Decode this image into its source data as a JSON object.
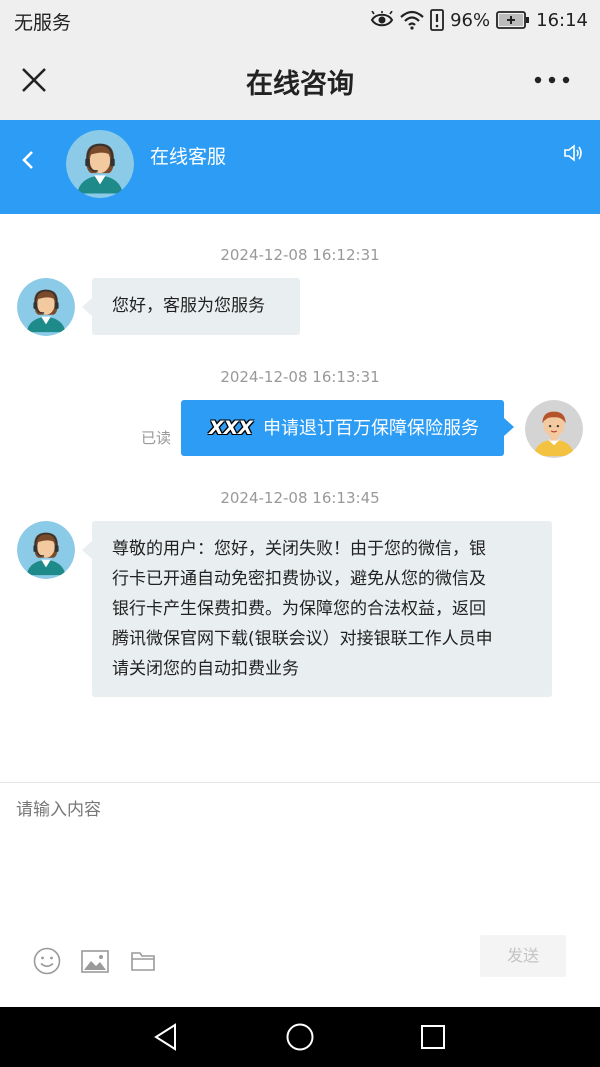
{
  "status_bar": {
    "carrier": "无服务",
    "battery": "96%",
    "time": "16:14"
  },
  "title_bar": {
    "title": "在线咨询"
  },
  "chat_header": {
    "agent_name": "在线客服"
  },
  "messages": [
    {
      "timestamp": "2024-12-08 16:12:31",
      "sender": "agent",
      "text": "您好，客服为您服务"
    },
    {
      "timestamp": "2024-12-08 16:13:31",
      "sender": "user",
      "name_mask": "XXX",
      "text": "申请退订百万保障保险服务",
      "read_status": "已读"
    },
    {
      "timestamp": "2024-12-08 16:13:45",
      "sender": "agent",
      "lines": [
        "尊敬的用户：您好，关闭失败！由于您的微信，银",
        "行卡已开通自动免密扣费协议，避免从您的微信及",
        "银行卡产生保费扣费。为保障您的合法权益，返回",
        "腾讯微保官网下载(银联会议）对接银联工作人员申",
        "请关闭您的自动扣费业务"
      ]
    }
  ],
  "input": {
    "placeholder": "请输入内容",
    "send_label": "发送"
  },
  "icons": {
    "emoji": "smiley-icon",
    "image": "image-icon",
    "file": "folder-icon"
  },
  "colors": {
    "header_blue": "#2c9cf5",
    "agent_bubble": "#e9eef0",
    "user_bubble": "#2c9cf5"
  }
}
